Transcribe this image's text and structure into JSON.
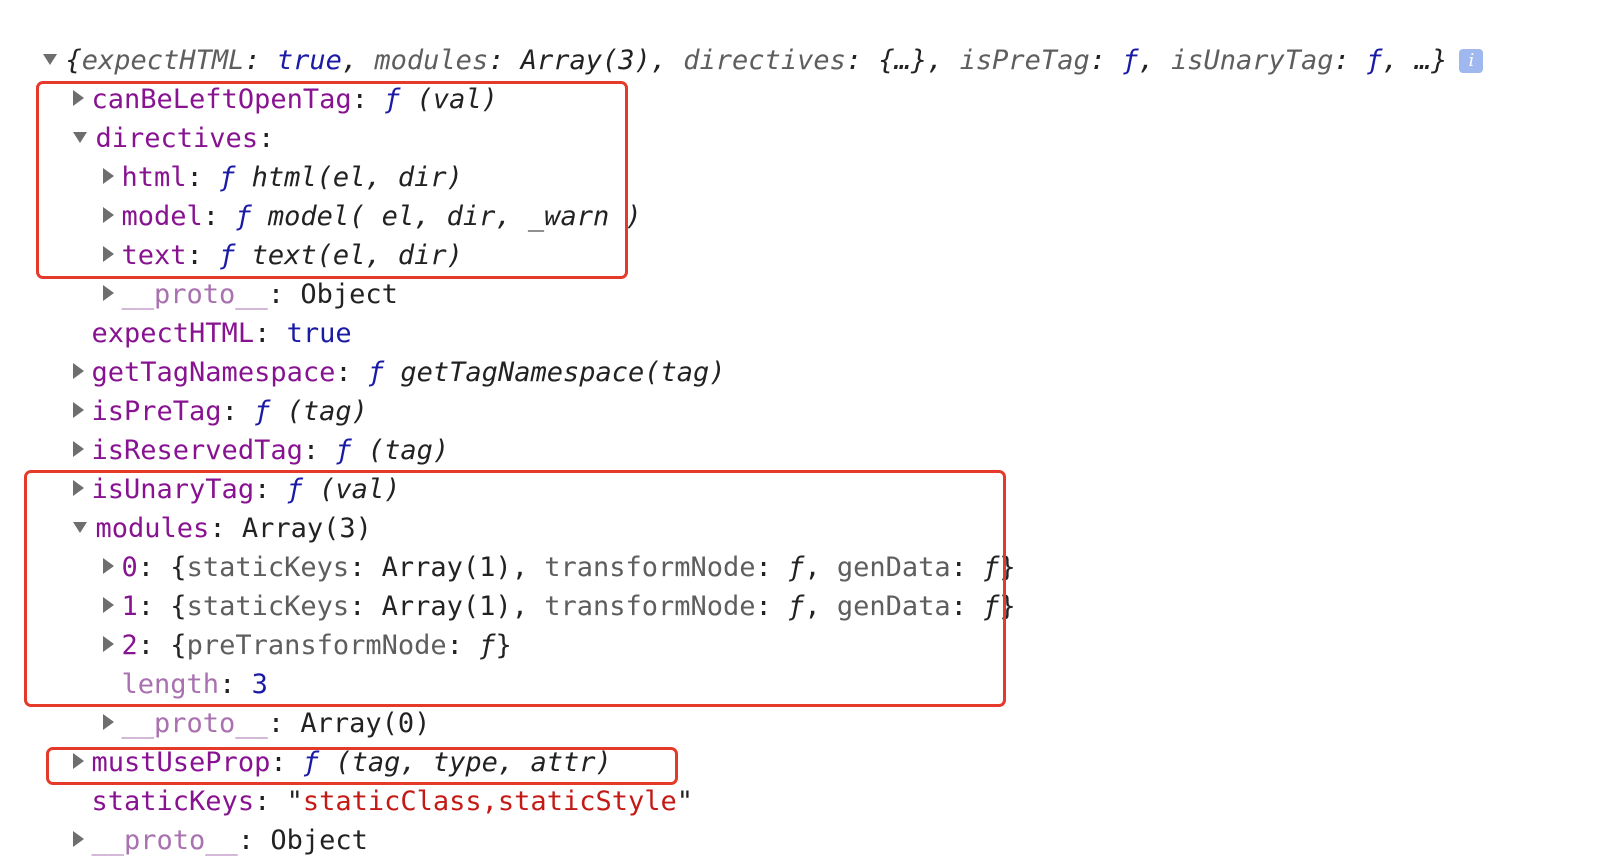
{
  "root": {
    "summary": {
      "open": "{",
      "k1": "expectHTML",
      "v1": "true",
      "k2": "modules",
      "v2": "Array(3)",
      "k3": "directives",
      "v3": "{…}",
      "k4": "isPreTag",
      "v4": "ƒ",
      "k5": "isUnaryTag",
      "v5": "ƒ",
      "tail": "…}"
    },
    "info": "i"
  },
  "props": {
    "canBeLeftOpenTag": {
      "key": "canBeLeftOpenTag",
      "f": "ƒ",
      "sig": "(val)"
    },
    "directives": {
      "key": "directives",
      "html": {
        "key": "html",
        "f": "ƒ",
        "sig": "html(el, dir)"
      },
      "model": {
        "key": "model",
        "f": "ƒ",
        "sig": "model( el, dir, _warn )"
      },
      "text": {
        "key": "text",
        "f": "ƒ",
        "sig": "text(el, dir)"
      },
      "proto": {
        "key": "__proto__",
        "value": "Object"
      }
    },
    "expectHTML": {
      "key": "expectHTML",
      "value": "true"
    },
    "getTagNamespace": {
      "key": "getTagNamespace",
      "f": "ƒ",
      "sig": "getTagNamespace(tag)"
    },
    "isPreTag": {
      "key": "isPreTag",
      "f": "ƒ",
      "sig": "(tag)"
    },
    "isReservedTag": {
      "key": "isReservedTag",
      "f": "ƒ",
      "sig": "(tag)"
    },
    "isUnaryTag": {
      "key": "isUnaryTag",
      "f": "ƒ",
      "sig": "(val)"
    },
    "modules": {
      "key": "modules",
      "value": "Array(3)",
      "items": [
        {
          "key": "0",
          "a": "staticKeys",
          "av": "Array(1)",
          "b": "transformNode",
          "bv": "ƒ",
          "c": "genData",
          "cv": "ƒ"
        },
        {
          "key": "1",
          "a": "staticKeys",
          "av": "Array(1)",
          "b": "transformNode",
          "bv": "ƒ",
          "c": "genData",
          "cv": "ƒ"
        },
        {
          "key": "2",
          "a": "preTransformNode",
          "av": "ƒ"
        }
      ],
      "length": {
        "key": "length",
        "value": "3"
      },
      "proto": {
        "key": "__proto__",
        "value": "Array(0)"
      }
    },
    "mustUseProp": {
      "key": "mustUseProp",
      "f": "ƒ",
      "sig": "(tag, type, attr)"
    },
    "staticKeys": {
      "key": "staticKeys",
      "value": "staticClass,staticStyle"
    },
    "proto": {
      "key": "__proto__",
      "value": "Object"
    }
  },
  "colors": {
    "highlight": "#e53a2a",
    "key": "#881391",
    "function": "#1a1aa6",
    "string": "#c41a16"
  }
}
